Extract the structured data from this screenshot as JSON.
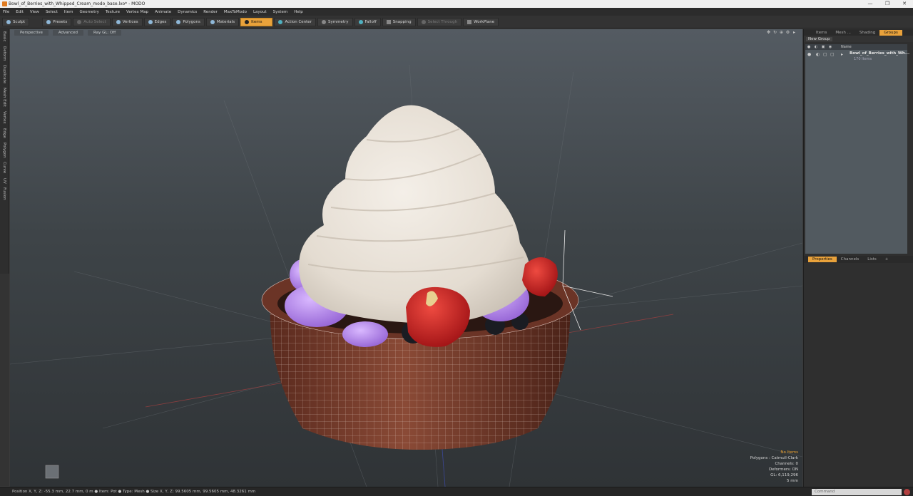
{
  "window": {
    "title": "Bowl_of_Berries_with_Whipped_Cream_modo_base.lxo* - MODO",
    "min": "—",
    "max": "❐",
    "close": "✕"
  },
  "menu": [
    "File",
    "Edit",
    "View",
    "Select",
    "Item",
    "Geometry",
    "Texture",
    "Vertex Map",
    "Animate",
    "Dynamics",
    "Render",
    "MaxToModo",
    "Layout",
    "System",
    "Help"
  ],
  "toolbar": {
    "sculpt": "Sculpt",
    "presets": "Presets",
    "auto_select": "Auto Select",
    "vertices": "Vertices",
    "edges": "Edges",
    "polygons": "Polygons",
    "materials": "Materials",
    "items": "Items",
    "action_center": "Action Center",
    "symmetry": "Symmetry",
    "falloff": "Falloff",
    "snapping": "Snapping",
    "select_through": "Select Through",
    "workplane": "WorkPlane"
  },
  "left_tabs": [
    "Basic",
    "Deform",
    "Duplicate",
    "Mesh Edit",
    "Vertex",
    "Edge",
    "Polygon",
    "Curve",
    "UV",
    "Fusion"
  ],
  "viewport": {
    "view": "Perspective",
    "shading": "Advanced",
    "ray_gl": "Ray GL: Off",
    "info": {
      "no_items": "No Items",
      "polygons": "Polygons : Catmull-Clark",
      "channels": "Channels: 0",
      "deformers": "Deformers: ON",
      "gl": "GL: 6,119,296",
      "scale": "5 mm"
    }
  },
  "right_panel": {
    "tabs": [
      "Items",
      "Mesh ...",
      "Shading",
      "Groups"
    ],
    "active_tab": "Groups",
    "new_group": "New Group",
    "name_header": "Name",
    "group_name": "Bowl_of_Berries_with_Wh...",
    "group_count": "170 Items",
    "bottom_tabs": [
      "Properties",
      "Channels",
      "Lists"
    ],
    "bottom_add": "+"
  },
  "statusbar": {
    "text": "Position X, Y, Z:  -55.3 mm, 22.7 mm, 0 m  ●  Item:  Pot  ●  Type:  Mesh  ●  Size X, Y, Z:  99.5605 mm, 99.5605 mm, 48.3261 mm",
    "command_placeholder": "Command"
  },
  "colors": {
    "accent": "#e9a23b",
    "cream": "#ece5dc",
    "bowl": "#7a3f2e",
    "berry_purple": "#b58ae6",
    "strawberry": "#d0262c"
  }
}
